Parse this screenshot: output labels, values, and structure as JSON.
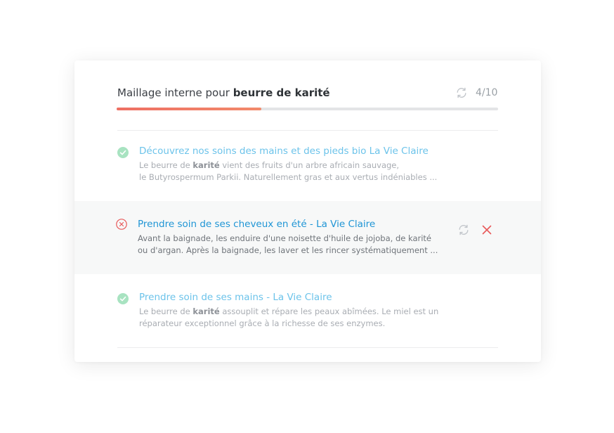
{
  "header": {
    "title_prefix": "Maillage interne pour ",
    "title_keyword": "beurre de karité",
    "counter": "4/10",
    "progress": 0.38
  },
  "items": [
    {
      "status": "success",
      "title": "Découvrez nos soins des mains et des pieds bio La Vie Claire",
      "excerpt_line1_before": "Le beurre de ",
      "excerpt_line1_bold": "karité",
      "excerpt_line1_after": " vient des fruits d'un arbre africain sauvage,",
      "excerpt_line2": "le Butyrospermum Parkii. Naturellement gras et aux vertus indéniables ..."
    },
    {
      "status": "error",
      "title": "Prendre soin de ses cheveux en été - La Vie Claire",
      "excerpt_line1_before": "Avant la baignade, les enduire d'une noisette d'huile de jojoba, de ",
      "excerpt_line1_bold": "karité",
      "excerpt_line1_after": "",
      "excerpt_line2": "ou d'argan. Après la baignade, les laver et les rincer systématiquement ..."
    },
    {
      "status": "success",
      "title": "Prendre soin de ses mains - La Vie Claire",
      "excerpt_line1_before": "Le beurre de ",
      "excerpt_line1_bold": "karité",
      "excerpt_line1_after": " assouplit et répare les peaux abîmées. Le miel est un",
      "excerpt_line2": "réparateur exceptionnel grâce à la richesse de ses enzymes."
    }
  ],
  "colors": {
    "progress": "#ee6f63",
    "success": "#a8e3c1",
    "error": "#e8595a",
    "link": "#6cc3ea",
    "link_active": "#1f95d5"
  },
  "icons": {
    "refresh": "refresh-icon",
    "success": "check-circle-icon",
    "error": "x-circle-icon",
    "remove": "close-icon"
  }
}
